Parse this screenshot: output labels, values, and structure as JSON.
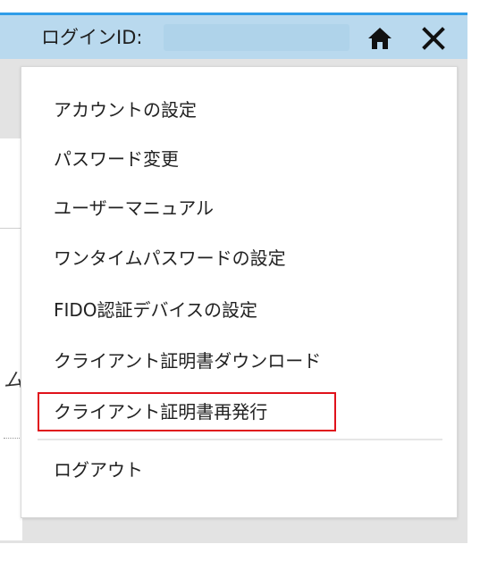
{
  "header": {
    "login_id_label": "ログインID:",
    "login_id_value": "",
    "home_icon": "home-icon",
    "close_icon": "close-icon"
  },
  "menu": {
    "items": [
      {
        "label": "アカウントの設定"
      },
      {
        "label": "パスワード変更"
      },
      {
        "label": "ユーザーマニュアル"
      },
      {
        "label": "ワンタイムパスワードの設定"
      },
      {
        "label": "FIDO認証デバイスの設定"
      },
      {
        "label": "クライアント証明書ダウンロード"
      },
      {
        "label": "クライアント証明書再発行"
      },
      {
        "label": "ログアウト"
      }
    ],
    "highlight_color": "#e0121b"
  },
  "colors": {
    "header_bg": "#b9d9ee",
    "header_accent": "#2f9de8"
  }
}
